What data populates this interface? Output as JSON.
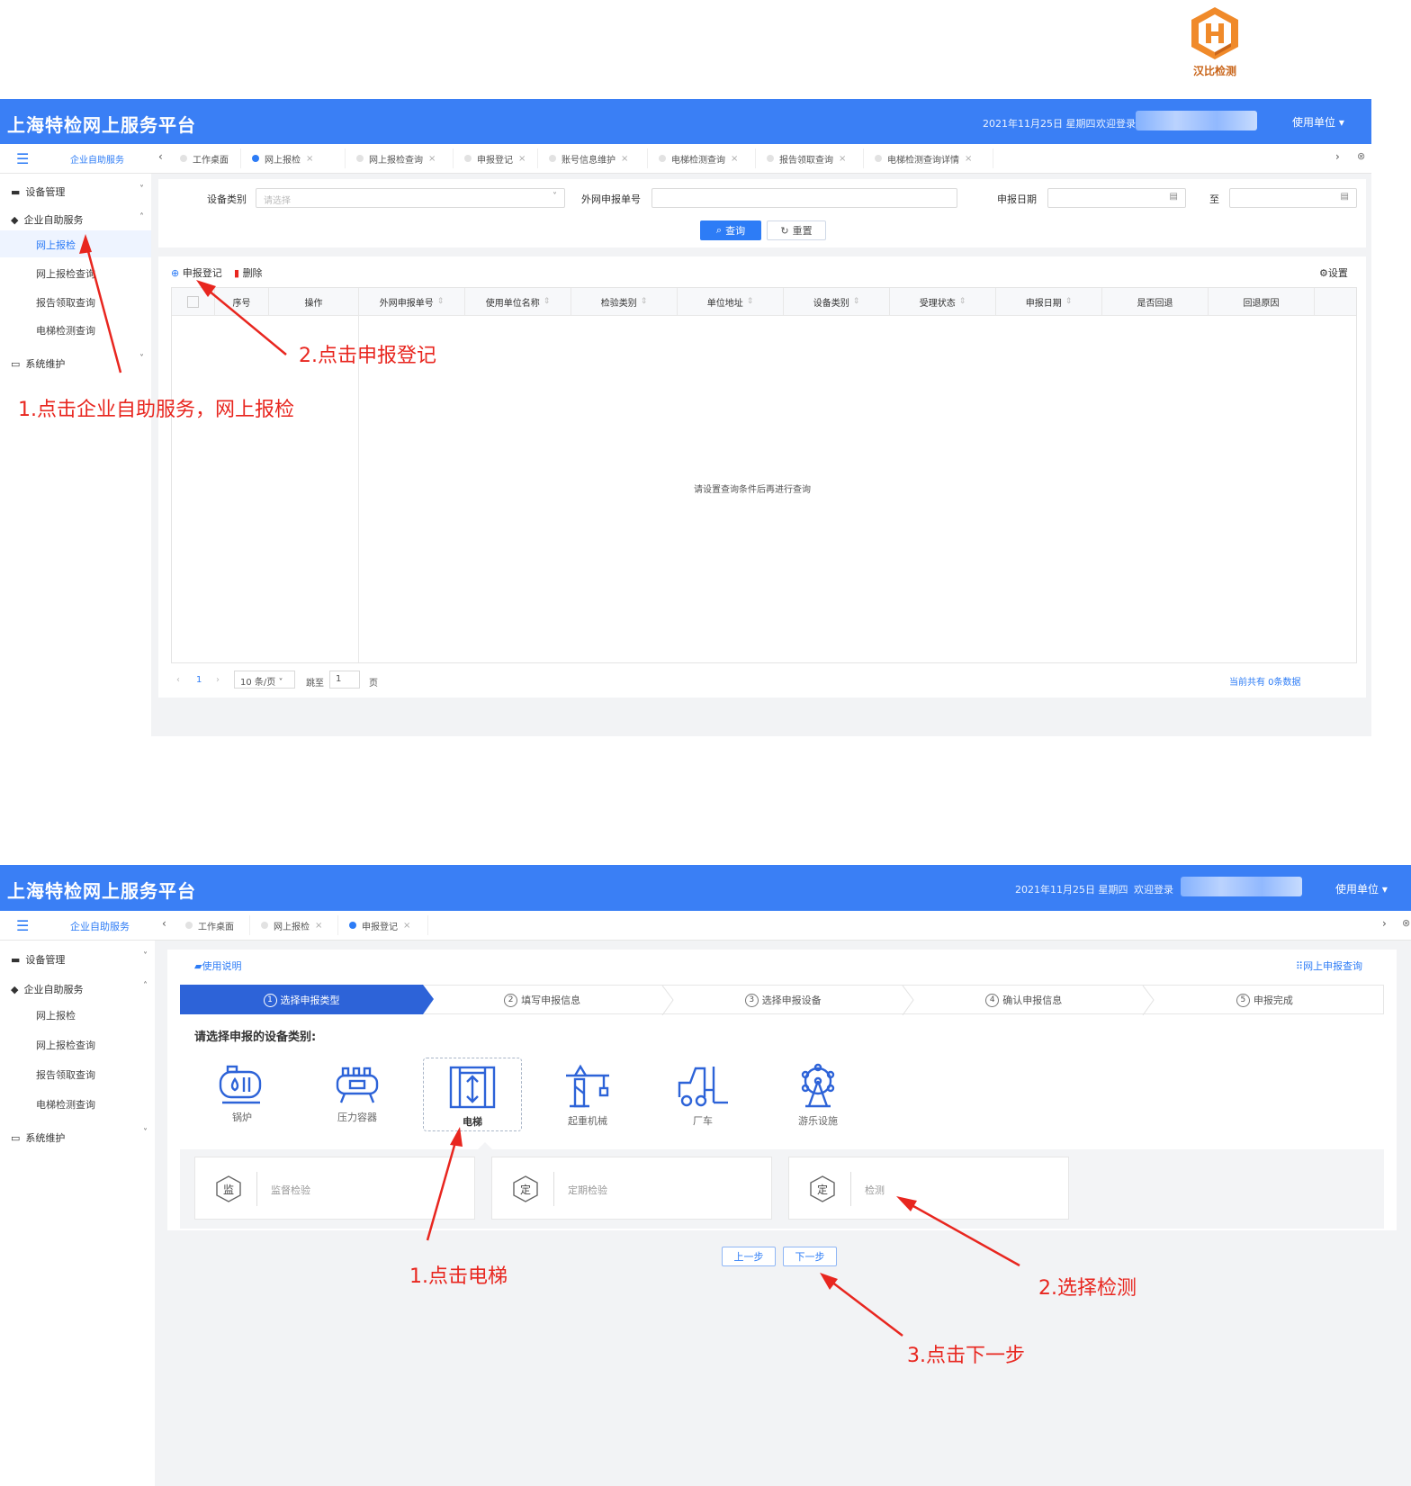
{
  "logo": {
    "text": "汉比检测"
  },
  "screen1": {
    "brand": "上海特检网上服务平台",
    "datetime": "2021年11月25日 星期四",
    "welcome": "欢迎登录",
    "unit": "使用单位",
    "sidebar_header": "企业自助服务",
    "tabs": [
      {
        "label": "工作桌面",
        "active": false,
        "closable": false
      },
      {
        "label": "网上报检",
        "active": true,
        "closable": true
      },
      {
        "label": "网上报检查询",
        "active": false,
        "closable": true
      },
      {
        "label": "申报登记",
        "active": false,
        "closable": true
      },
      {
        "label": "账号信息维护",
        "active": false,
        "closable": true
      },
      {
        "label": "电梯检测查询",
        "active": false,
        "closable": true
      },
      {
        "label": "报告领取查询",
        "active": false,
        "closable": true
      },
      {
        "label": "电梯检测查询详情",
        "active": false,
        "closable": true
      }
    ],
    "menu": {
      "equipment": "设备管理",
      "self_service": "企业自助服务",
      "sub": [
        "网上报检",
        "网上报检查询",
        "报告领取查询",
        "电梯检测查询"
      ],
      "system": "系统维护"
    },
    "filters": {
      "category_label": "设备类别",
      "category_placeholder": "请选择",
      "extnum_label": "外网申报单号",
      "date_label": "申报日期",
      "to_label": "至"
    },
    "buttons": {
      "query": "查询",
      "reset": "重置",
      "register": "申报登记",
      "delete": "删除",
      "settings": "设置"
    },
    "columns": [
      "序号",
      "操作",
      "外网申报单号",
      "使用单位名称",
      "检验类别",
      "单位地址",
      "设备类别",
      "受理状态",
      "申报日期",
      "是否回退",
      "回退原因"
    ],
    "empty_text": "请设置查询条件后再进行查询",
    "pagination": {
      "page": "1",
      "page_size": "10 条/页",
      "goto_label": "跳至",
      "goto_value": "1",
      "page_suffix": "页",
      "total": "当前共有 0条数据"
    },
    "annotations": {
      "a1": "1.点击企业自助服务，网上报检",
      "a2": "2.点击申报登记"
    }
  },
  "screen2": {
    "brand": "上海特检网上服务平台",
    "datetime": "2021年11月25日 星期四",
    "welcome": "欢迎登录",
    "unit": "使用单位",
    "sidebar_header": "企业自助服务",
    "tabs": [
      {
        "label": "工作桌面",
        "active": false,
        "closable": false
      },
      {
        "label": "网上报检",
        "active": false,
        "closable": true
      },
      {
        "label": "申报登记",
        "active": true,
        "closable": true
      }
    ],
    "menu": {
      "equipment": "设备管理",
      "self_service": "企业自助服务",
      "sub": [
        "网上报检",
        "网上报检查询",
        "报告领取查询",
        "电梯检测查询"
      ],
      "system": "系统维护"
    },
    "usage_link": "使用说明",
    "query_link": "网上申报查询",
    "steps": [
      {
        "num": "1",
        "label": "选择申报类型"
      },
      {
        "num": "2",
        "label": "填写申报信息"
      },
      {
        "num": "3",
        "label": "选择申报设备"
      },
      {
        "num": "4",
        "label": "确认申报信息"
      },
      {
        "num": "5",
        "label": "申报完成"
      }
    ],
    "prompt": "请选择申报的设备类别:",
    "categories": [
      {
        "label": "锅炉",
        "icon": "boiler-icon"
      },
      {
        "label": "压力容器",
        "icon": "pressure-vessel-icon"
      },
      {
        "label": "电梯",
        "icon": "elevator-icon"
      },
      {
        "label": "起重机械",
        "icon": "crane-icon"
      },
      {
        "label": "厂车",
        "icon": "forklift-icon"
      },
      {
        "label": "游乐设施",
        "icon": "ferris-wheel-icon"
      }
    ],
    "options": [
      {
        "badge": "监",
        "label": "监督检验"
      },
      {
        "badge": "定",
        "label": "定期检验"
      },
      {
        "badge": "定",
        "label": "检测"
      }
    ],
    "prev_button": "上一步",
    "next_button": "下一步",
    "annotations": {
      "a1": "1.点击电梯",
      "a2": "2.选择检测",
      "a3": "3.点击下一步"
    }
  },
  "colors": {
    "primary": "#3a7ff5",
    "annotation": "#e8261f"
  }
}
